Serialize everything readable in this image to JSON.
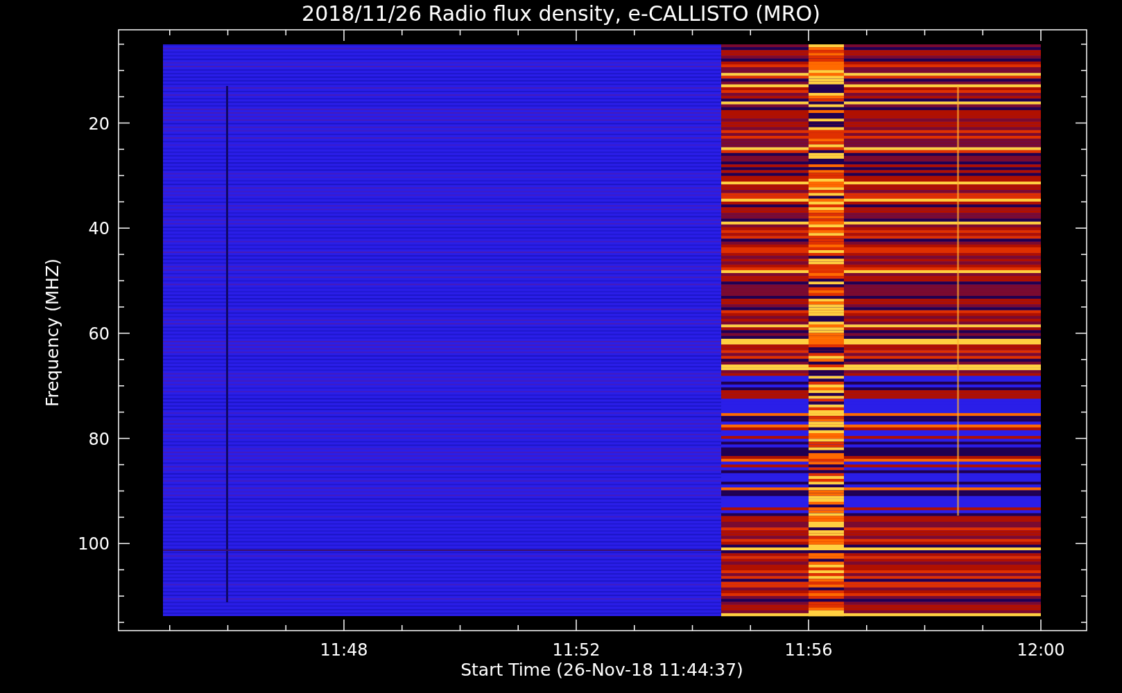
{
  "title": "2018/11/26  Radio flux density, e-CALLISTO (MRO)",
  "y_axis": {
    "label": "Frequency (MHZ)",
    "ticks": [
      "20",
      "40",
      "60",
      "80",
      "100"
    ]
  },
  "x_axis": {
    "label": "Start Time (26-Nov-18 11:44:37)",
    "ticks": [
      "11:48",
      "11:52",
      "11:56",
      "12:00"
    ]
  }
}
